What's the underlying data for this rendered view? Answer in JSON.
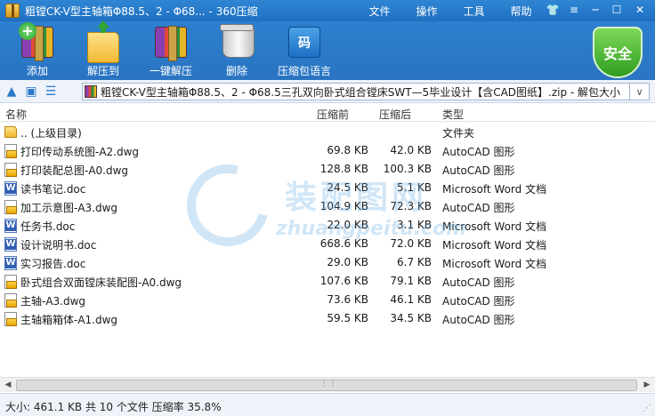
{
  "window": {
    "title": "粗镗CK-V型主轴箱Φ88.5、2 - Φ68... - 360压缩",
    "menu": [
      "文件",
      "操作",
      "工具",
      "帮助"
    ]
  },
  "toolbar": {
    "buttons": [
      {
        "label": "添加",
        "icon": "add-archive-icon"
      },
      {
        "label": "解压到",
        "icon": "extract-to-icon"
      },
      {
        "label": "一键解压",
        "icon": "one-click-extract-icon"
      },
      {
        "label": "删除",
        "icon": "delete-icon"
      },
      {
        "label": "压缩包语言",
        "icon": "archive-language-icon"
      }
    ],
    "language_glyph": "码",
    "shield_label": "安全"
  },
  "address": {
    "path": "粗镗CK-V型主轴箱Φ88.5、2 - Φ68.5三孔双向卧式组合镗床SWT—5毕业设计【含CAD图纸】.zip - 解包大小"
  },
  "columns": {
    "name": "名称",
    "compressed": "压缩前",
    "uncompressed": "压缩后",
    "type": "类型"
  },
  "files": [
    {
      "name": ".. (上级目录)",
      "compressed": "",
      "uncompressed": "",
      "type": "文件夹",
      "kind": "folder"
    },
    {
      "name": "打印传动系统图-A2.dwg",
      "compressed": "69.8 KB",
      "uncompressed": "42.0 KB",
      "type": "AutoCAD 图形",
      "kind": "dwg"
    },
    {
      "name": "打印装配总图-A0.dwg",
      "compressed": "128.8 KB",
      "uncompressed": "100.3 KB",
      "type": "AutoCAD 图形",
      "kind": "dwg"
    },
    {
      "name": "读书笔记.doc",
      "compressed": "24.5 KB",
      "uncompressed": "5.1 KB",
      "type": "Microsoft Word 文档",
      "kind": "doc"
    },
    {
      "name": "加工示意图-A3.dwg",
      "compressed": "104.9 KB",
      "uncompressed": "72.3 KB",
      "type": "AutoCAD 图形",
      "kind": "dwg"
    },
    {
      "name": "任务书.doc",
      "compressed": "22.0 KB",
      "uncompressed": "3.1 KB",
      "type": "Microsoft Word 文档",
      "kind": "doc"
    },
    {
      "name": "设计说明书.doc",
      "compressed": "668.6 KB",
      "uncompressed": "72.0 KB",
      "type": "Microsoft Word 文档",
      "kind": "doc"
    },
    {
      "name": "实习报告.doc",
      "compressed": "29.0 KB",
      "uncompressed": "6.7 KB",
      "type": "Microsoft Word 文档",
      "kind": "doc"
    },
    {
      "name": "卧式组合双面镗床装配图-A0.dwg",
      "compressed": "107.6 KB",
      "uncompressed": "79.1 KB",
      "type": "AutoCAD 图形",
      "kind": "dwg"
    },
    {
      "name": "主轴-A3.dwg",
      "compressed": "73.6 KB",
      "uncompressed": "46.1 KB",
      "type": "AutoCAD 图形",
      "kind": "dwg"
    },
    {
      "name": "主轴箱箱体-A1.dwg",
      "compressed": "59.5 KB",
      "uncompressed": "34.5 KB",
      "type": "AutoCAD 图形",
      "kind": "dwg"
    }
  ],
  "watermark": {
    "cn": "装配图网",
    "en": "zhuangpeitu.com"
  },
  "status": {
    "text": "大小: 461.1 KB 共 10 个文件 压缩率 35.8%"
  }
}
